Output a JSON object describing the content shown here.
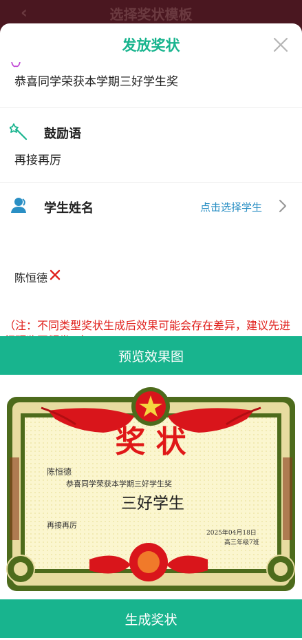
{
  "background_page": {
    "title": "选择奖状模板",
    "back_icon": "chevron-left-icon"
  },
  "sheet": {
    "title": "发放奖状",
    "award_text": "恭喜同学荣获本学期三好学生奖",
    "encouragement": {
      "label": "鼓励语",
      "value": "再接再厉",
      "icon": "magic-wand-icon"
    },
    "student": {
      "label": "学生姓名",
      "select_link": "点击选择学生",
      "icon": "user-icon",
      "selected": "陈恒德"
    },
    "note": "（注：不同类型奖状生成后效果可能会存在差异，建议先进行预览再颁发！）",
    "preview_button": "预览效果图",
    "generate_button": "生成奖状"
  },
  "certificate": {
    "heading": "奖 状",
    "student_name": "陈恒德",
    "award_line": "恭喜同学荣获本学期三好学生奖",
    "title": "三好学生",
    "encouragement": "再接再厉",
    "date": "2025年04月18日",
    "class": "高三年级7班"
  },
  "colors": {
    "accent": "#18b48e",
    "link": "#2a8fc4",
    "note": "#e0201c",
    "certificate_red": "#e01818",
    "certificate_green": "#4d6b1c"
  }
}
